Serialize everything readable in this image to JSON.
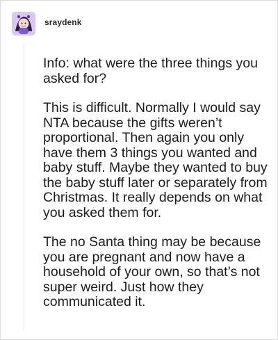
{
  "post": {
    "username": "sraydenk",
    "paragraphs": [
      "Info: what were the three things you asked for?",
      "This is difficult. Normally I would say NTA because the gifts weren’t proportional. Then again you only have them 3 things you wanted and baby stuff. Maybe they wanted to buy the baby stuff later or separately from Christmas. It really depends on what you asked them for.",
      "The no Santa thing may be because you are pregnant and now have a household of your own, so that’s not super weird. Just how they communicated it."
    ]
  },
  "icons": {
    "avatar": "avatar-illustration"
  },
  "colors": {
    "avatar_bg": "#7a5cc4",
    "hair": "#2a2140",
    "skin": "#f4d8d0",
    "text": "#1c1c1c",
    "line": "#e3e3e3"
  }
}
